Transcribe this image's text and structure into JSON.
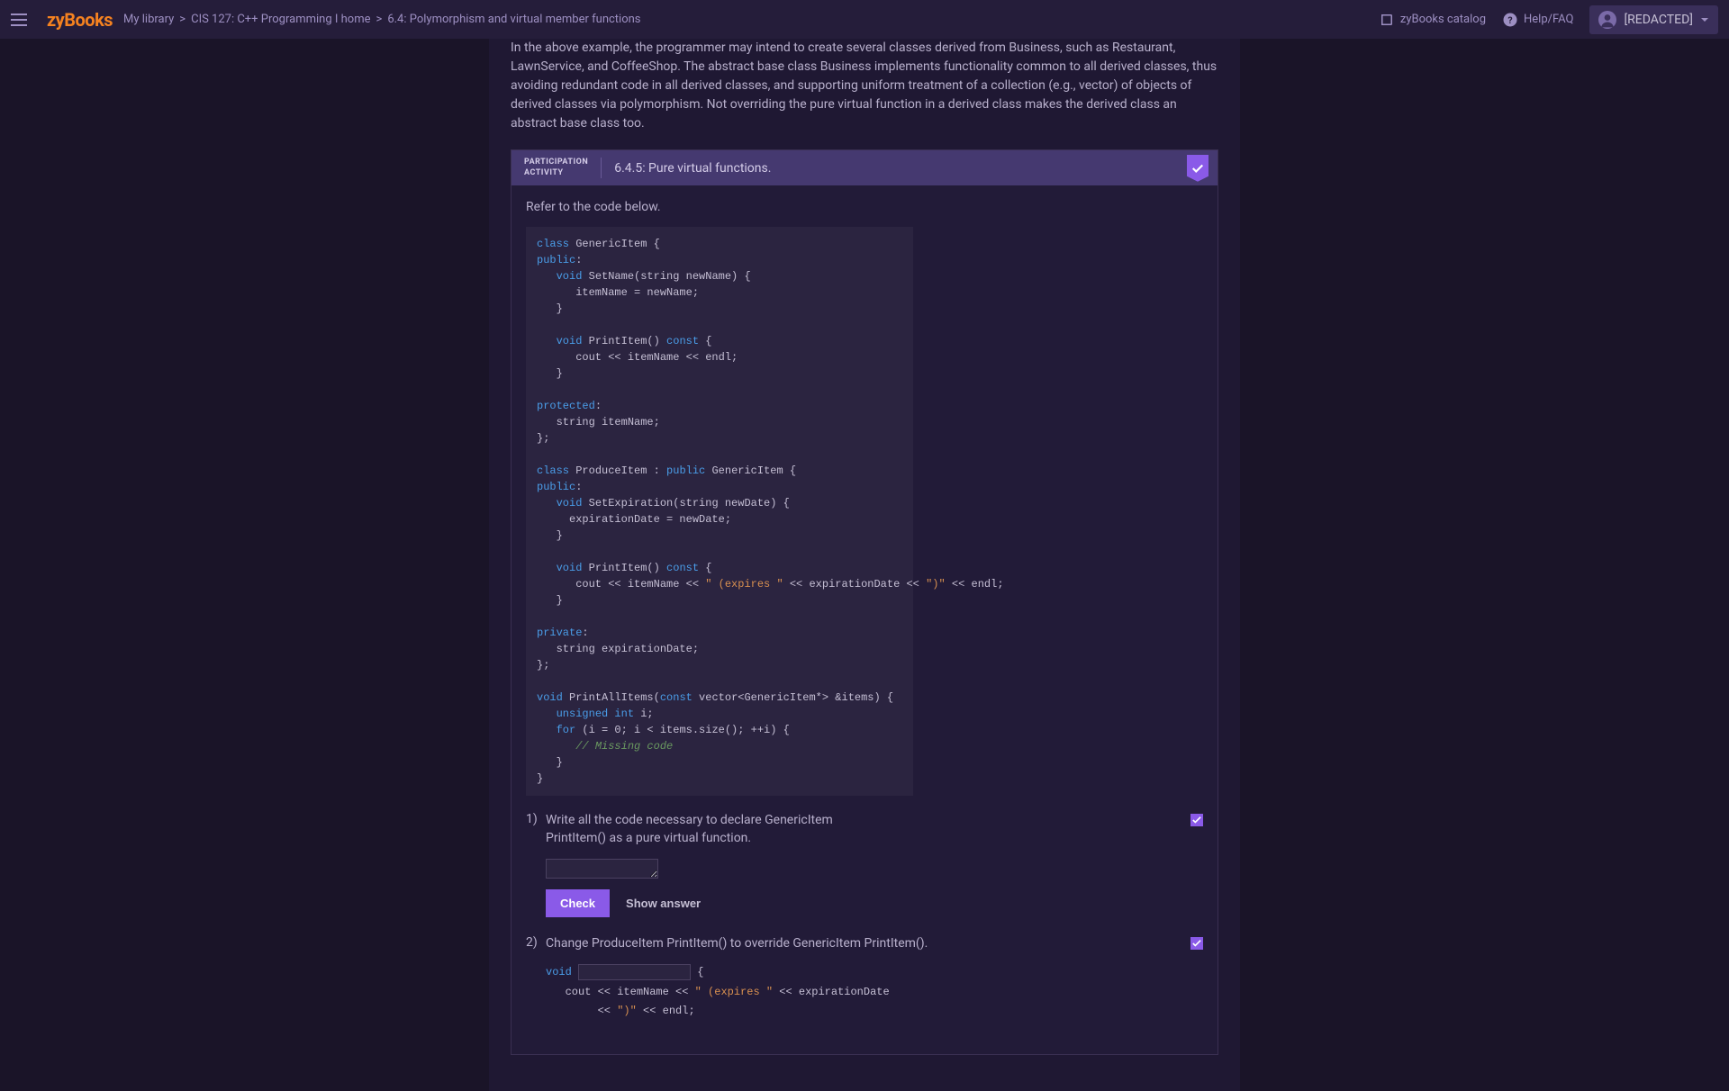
{
  "topbar": {
    "logo": "zyBooks",
    "breadcrumb": {
      "library": "My library",
      "course": "CIS 127: C++ Programming I home",
      "section": "6.4: Polymorphism and virtual member functions"
    },
    "catalog": "zyBooks catalog",
    "help": "Help/FAQ",
    "user": "[REDACTED]"
  },
  "intro": "In the above example, the programmer may intend to create several classes derived from Business, such as Restaurant, LawnService, and CoffeeShop. The abstract base class Business implements functionality common to all derived classes, thus avoiding redundant code in all derived classes, and supporting uniform treatment of a collection (e.g., vector) of objects of derived classes via polymorphism. Not overriding the pure virtual function in a derived class makes the derived class an abstract base class too.",
  "activity": {
    "label_line1": "PARTICIPATION",
    "label_line2": "ACTIVITY",
    "title": "6.4.5: Pure virtual functions.",
    "refer": "Refer to the code below."
  },
  "q1": {
    "num": "1)",
    "text": "Write all the code necessary to declare GenericItem PrintItem() as a pure virtual function.",
    "check": "Check",
    "show": "Show answer"
  },
  "q2": {
    "num": "2)",
    "text": "Change ProduceItem PrintItem() to override GenericItem PrintItem()."
  },
  "code2": {
    "void": "void",
    "brace": " {",
    "line2a": "   cout << itemName << ",
    "str1": "\" (expires \"",
    "line2b": " << expirationDate",
    "line3a": "        << ",
    "str2": "\")\"",
    "line3b": " << endl;"
  }
}
